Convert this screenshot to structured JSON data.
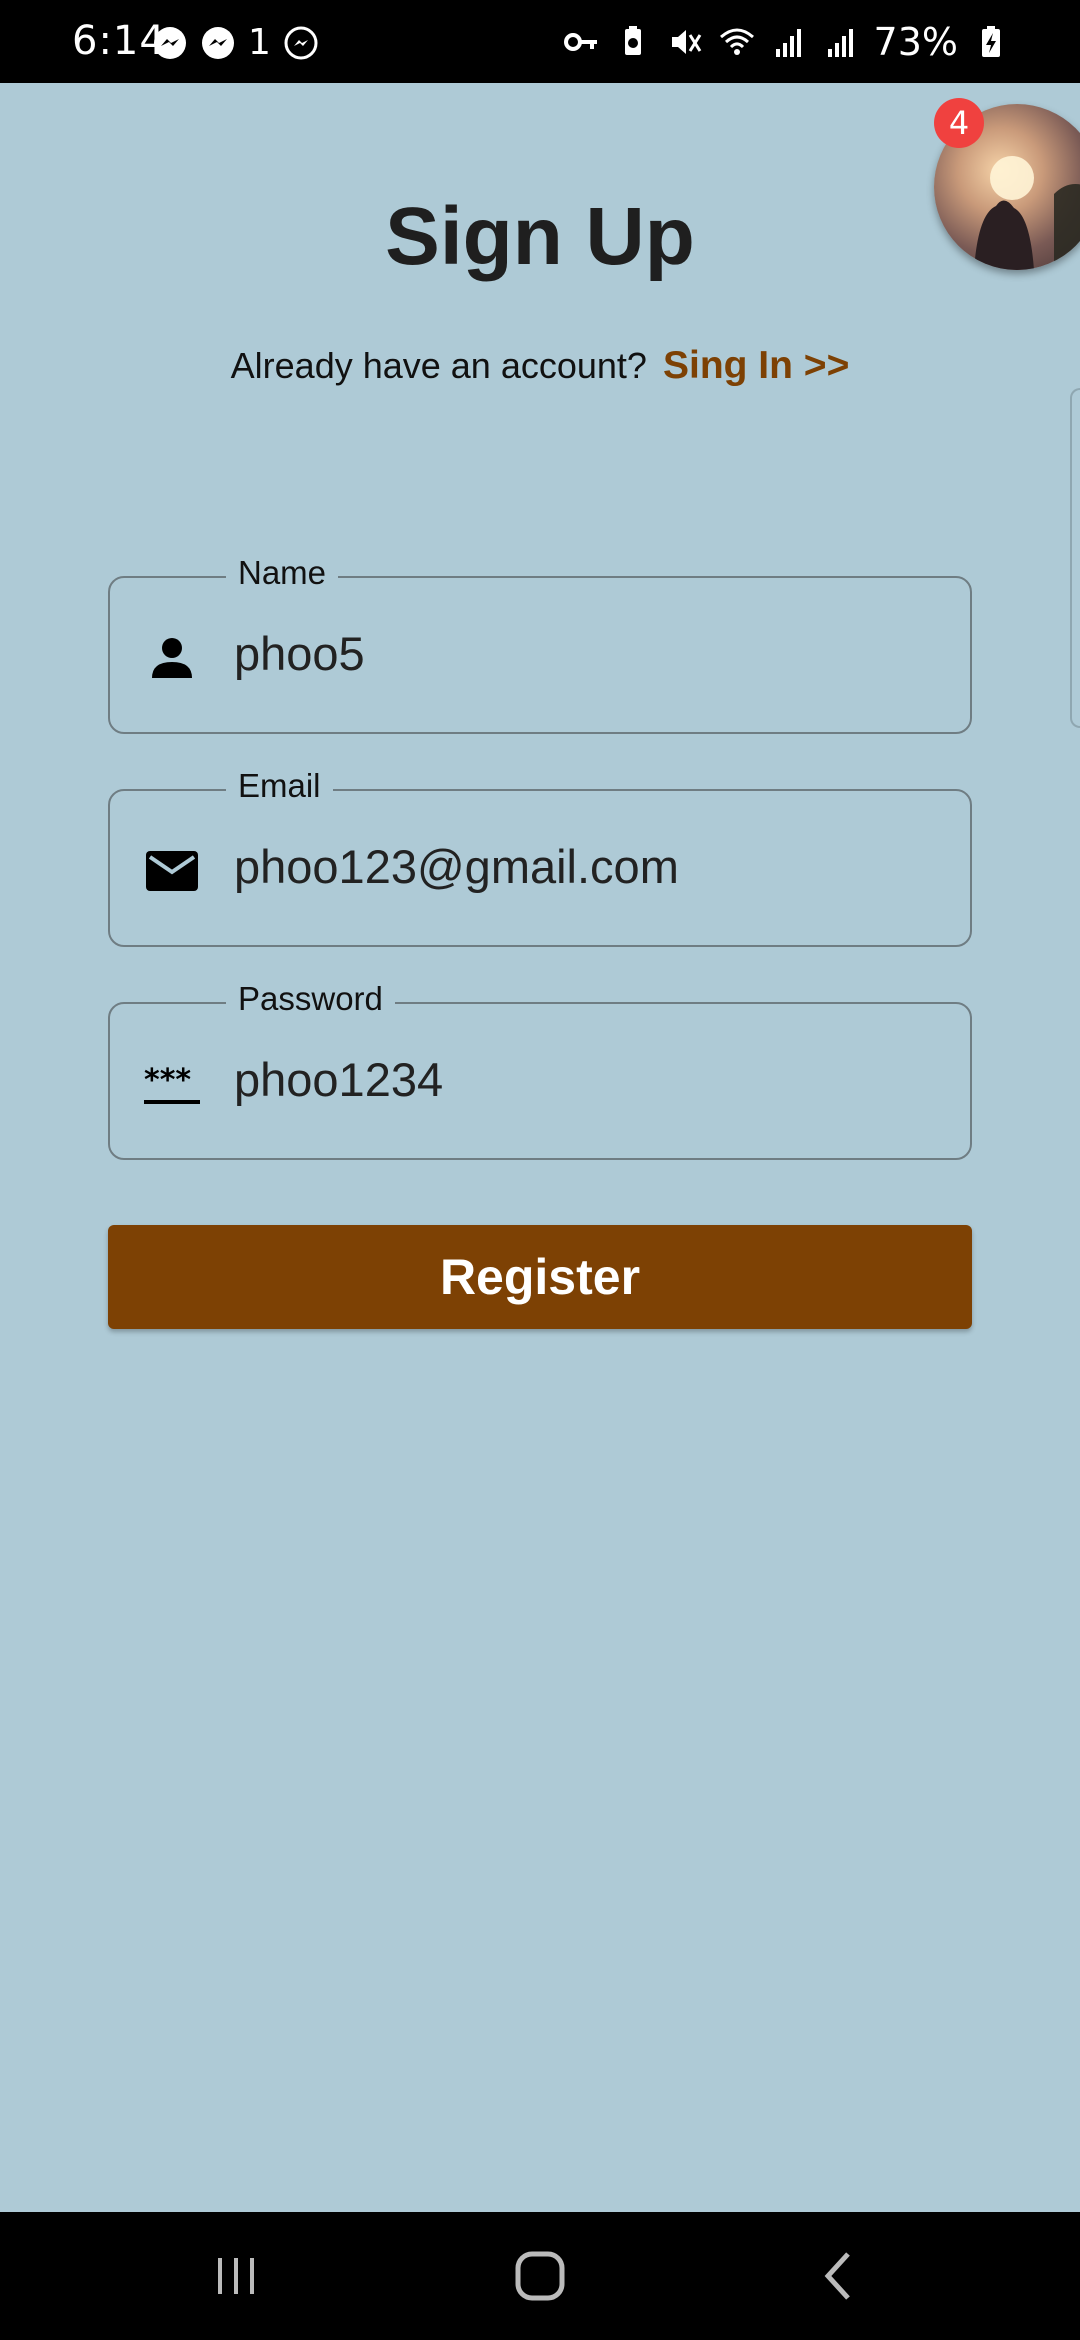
{
  "status_bar": {
    "time": "6:14",
    "signal_extra": "1",
    "battery_text": "73%"
  },
  "page": {
    "title": "Sign Up",
    "signin_prompt": "Already have an account?",
    "signin_link": "Sing In >>"
  },
  "form": {
    "name": {
      "label": "Name",
      "value": "phoo5",
      "icon": "person-icon"
    },
    "email": {
      "label": "Email",
      "value": "phoo123@gmail.com",
      "icon": "mail-icon"
    },
    "password": {
      "label": "Password",
      "value": "phoo1234",
      "icon": "password-icon"
    },
    "submit_label": "Register"
  },
  "chat_head": {
    "badge_count": "4"
  },
  "colors": {
    "background": "#aecad6",
    "accent": "#7d4104",
    "badge": "#f0413f"
  }
}
